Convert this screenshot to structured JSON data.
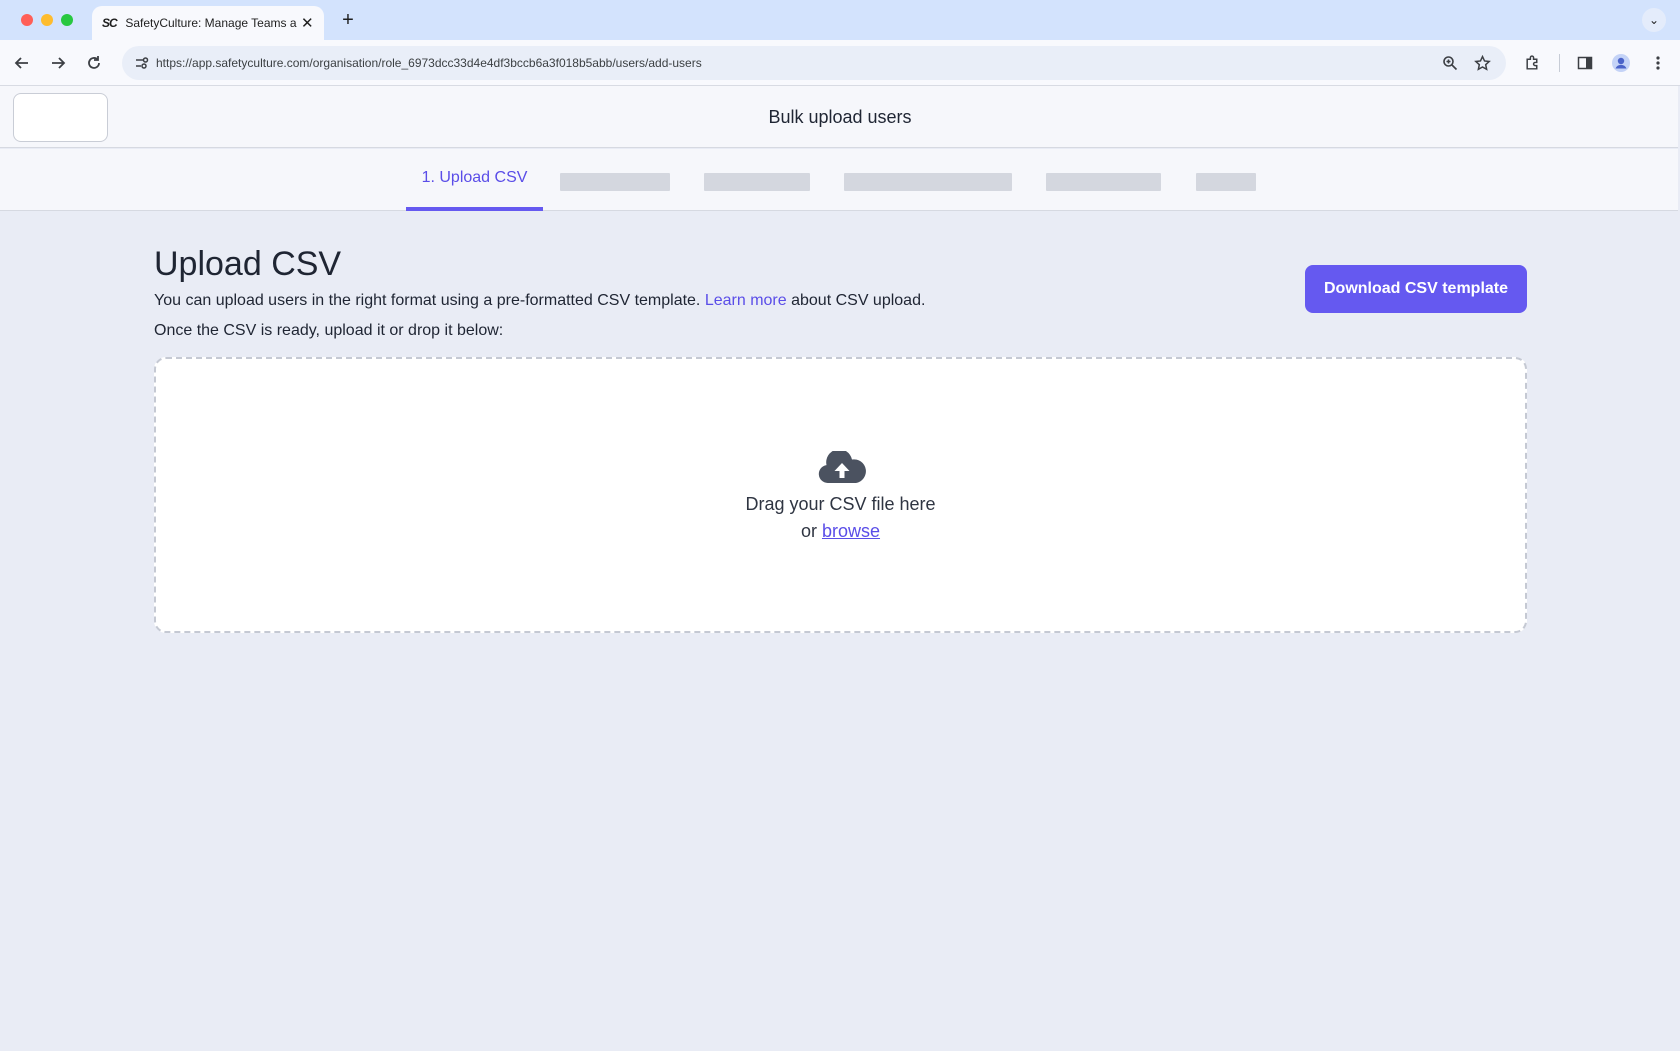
{
  "browser": {
    "tab_title": "SafetyCulture: Manage Teams and...",
    "tab_favicon_text": "SC",
    "url": "https://app.safetyculture.com/organisation/role_6973dcc33d4e4df3bccb6a3f018b5abb/users/add-users",
    "new_tab_icon": "plus-icon",
    "close_tab_icon": "close-icon"
  },
  "header": {
    "title": "Bulk upload users"
  },
  "steps": {
    "active_label": "1. Upload CSV"
  },
  "main": {
    "title": "Upload CSV",
    "intro_before": "You can upload users in the right format using a pre-formatted CSV template. ",
    "learn_more": "Learn more",
    "intro_after": " about CSV upload.",
    "instruction": "Once the CSV is ready, upload it or drop it below:",
    "download_button": "Download CSV template",
    "dropzone": {
      "drag_text": "Drag your CSV file here",
      "or_text": "or ",
      "browse_label": "browse"
    }
  },
  "colors": {
    "accent": "#6559f0",
    "link": "#5a4de8",
    "page_bg": "#e9ecf5"
  }
}
